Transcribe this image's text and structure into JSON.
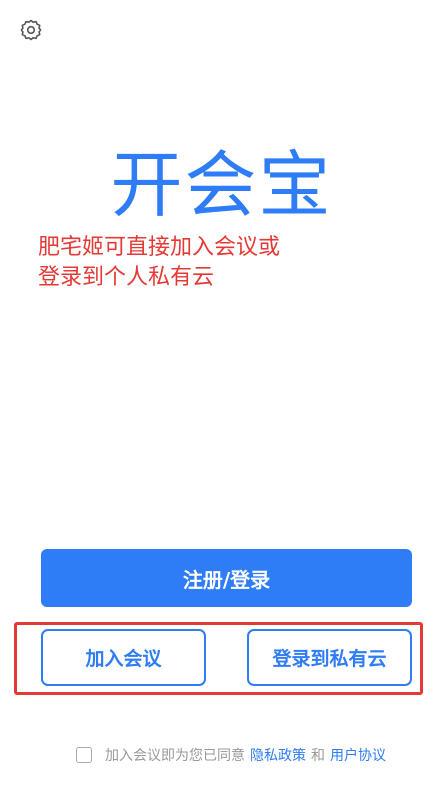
{
  "app": {
    "title": "开会宝"
  },
  "annotation": {
    "line1": "肥宅姬可直接加入会议或",
    "line2": "登录到个人私有云"
  },
  "buttons": {
    "register_login": "注册/登录",
    "join_meeting": "加入会议",
    "login_private_cloud": "登录到私有云"
  },
  "agreement": {
    "prefix": "加入会议即为您已同意",
    "privacy_policy": "隐私政策",
    "and": "和",
    "user_agreement": "用户协议",
    "checked": false
  },
  "icons": {
    "settings": "gear-icon"
  },
  "colors": {
    "brand_blue": "#2e7cf6",
    "annotation_red": "#e53935",
    "muted_text": "#999999"
  }
}
